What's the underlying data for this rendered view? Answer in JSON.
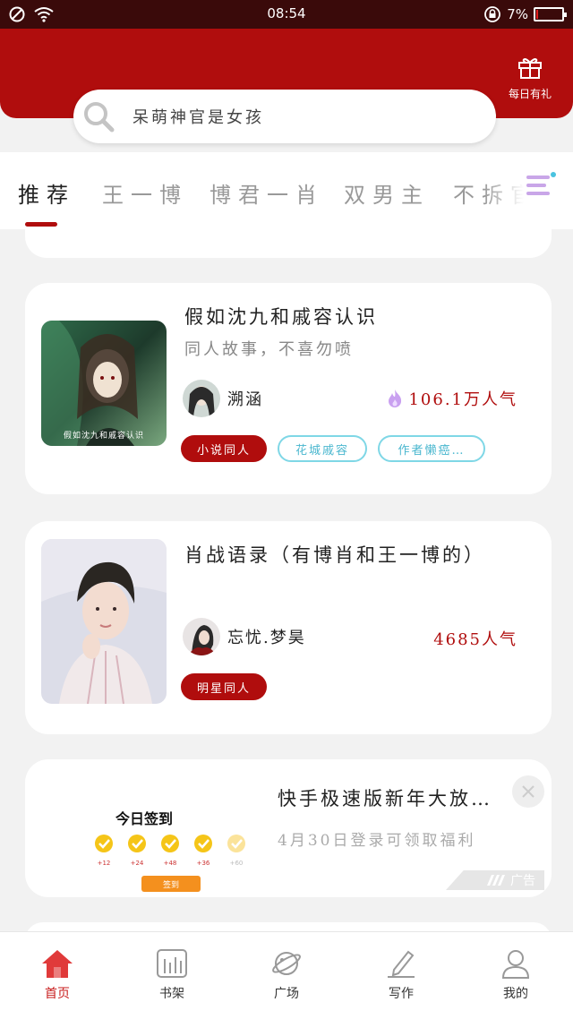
{
  "status_bar": {
    "time": "08:54",
    "battery": "7%",
    "battery_level": 0.07
  },
  "header": {
    "search_placeholder": "呆萌神官是女孩",
    "gift_label": "每日有礼",
    "brand_color": "#b00d0d"
  },
  "tabs": [
    {
      "label": "推荐",
      "active": true
    },
    {
      "label": "王一博",
      "active": false
    },
    {
      "label": "博君一肖",
      "active": false
    },
    {
      "label": "双男主",
      "active": false
    },
    {
      "label": "不拆官",
      "active": false
    }
  ],
  "feed": [
    {
      "title": "假如沈九和戚容认识",
      "description": "同人故事，不喜勿喷",
      "cover_text": "假如沈九和戚容认识",
      "author": "溯涵",
      "popularity": "106.1万人气",
      "hot_icon": "flame-icon",
      "tags": [
        "小说同人",
        "花城戚容",
        "作者懒癌…"
      ]
    },
    {
      "title": "肖战语录（有博肖和王一博的）",
      "description": "",
      "author": "忘忧.梦昊",
      "popularity": "4685人气",
      "tags": [
        "明星同人"
      ]
    }
  ],
  "ad": {
    "title": "快手极速版新年大放…",
    "subtitle": "4月30日登录可领取福利",
    "badge": "广告",
    "image": {
      "heading": "今日签到",
      "rewards": [
        "+12",
        "+24",
        "+48",
        "+36",
        "+60"
      ],
      "button": "签到"
    }
  },
  "bottom_nav": [
    {
      "label": "首页",
      "icon": "home-icon",
      "active": true
    },
    {
      "label": "书架",
      "icon": "bookshelf-icon",
      "active": false
    },
    {
      "label": "广场",
      "icon": "planet-icon",
      "active": false
    },
    {
      "label": "写作",
      "icon": "pen-icon",
      "active": false
    },
    {
      "label": "我的",
      "icon": "user-icon",
      "active": false
    }
  ]
}
